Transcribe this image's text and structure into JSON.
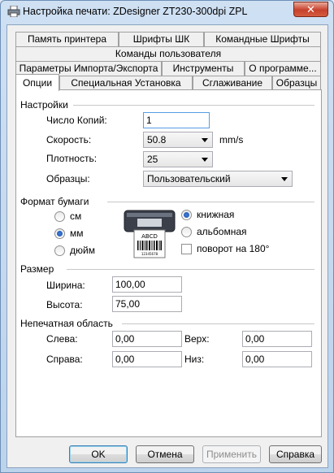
{
  "window": {
    "title": "Настройка печати: ZDesigner ZT230-300dpi ZPL",
    "close_glyph": "✕"
  },
  "tabs": {
    "row1": [
      "Память принтера",
      "Шрифты ШК",
      "Командные Шрифты"
    ],
    "row2": [
      "Команды пользователя"
    ],
    "row3": [
      "Параметры Импорта/Экспорта",
      "Инструменты",
      "О программе..."
    ],
    "row4": [
      "Опции",
      "Специальная Установка",
      "Сглаживание",
      "Образцы"
    ],
    "active": "Опции"
  },
  "settings": {
    "title": "Настройки",
    "copies_label": "Число Копий:",
    "copies_value": "1",
    "speed_label": "Скорость:",
    "speed_value": "50.8",
    "speed_unit": "mm/s",
    "density_label": "Плотность:",
    "density_value": "25",
    "samples_label": "Образцы:",
    "samples_value": "Пользовательский"
  },
  "paper_format": {
    "title": "Формат бумаги",
    "units": [
      "см",
      "мм",
      "дюйм"
    ],
    "selected_unit": "мм",
    "orientation": [
      "книжная",
      "альбомная"
    ],
    "selected_orientation": "книжная",
    "rotate_label": "поворот на 180°",
    "rotate_checked": false,
    "preview_label": "ABCD",
    "preview_code": "12345678"
  },
  "size": {
    "title": "Размер",
    "width_label": "Ширина:",
    "width_value": "100,00",
    "height_label": "Высота:",
    "height_value": "75,00"
  },
  "unprintable": {
    "title": "Непечатная область",
    "left_label": "Слева:",
    "left_value": "0,00",
    "top_label": "Верх:",
    "top_value": "0,00",
    "right_label": "Справа:",
    "right_value": "0,00",
    "bottom_label": "Низ:",
    "bottom_value": "0,00"
  },
  "buttons": {
    "ok": "OK",
    "cancel": "Отмена",
    "apply": "Применить",
    "help": "Справка"
  }
}
